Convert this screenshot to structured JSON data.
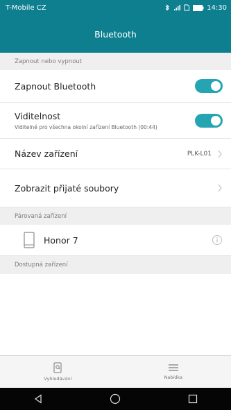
{
  "status": {
    "carrier": "T-Mobile CZ",
    "time": "14:30"
  },
  "header": {
    "title": "Bluetooth"
  },
  "sections": {
    "onoff": "Zapnout nebo vypnout",
    "paired": "Párovaná zařízení",
    "available": "Dostupná zařízení"
  },
  "rows": {
    "bluetooth": {
      "title": "Zapnout Bluetooth",
      "on": true
    },
    "visibility": {
      "title": "Viditelnost",
      "subtitle": "Viditelné pro všechna okolní zařízení Bluetooth (00:44)",
      "on": true
    },
    "device_name": {
      "title": "Název zařízení",
      "value": "PLK-L01"
    },
    "received_files": {
      "title": "Zobrazit přijaté soubory"
    }
  },
  "paired_devices": [
    {
      "name": "Honor 7"
    }
  ],
  "bottom": {
    "search_label": "Vyhledávání",
    "menu_label": "Nabídka"
  },
  "colors": {
    "accent": "#0e7f8f",
    "toggle_on": "#25a5b2"
  }
}
